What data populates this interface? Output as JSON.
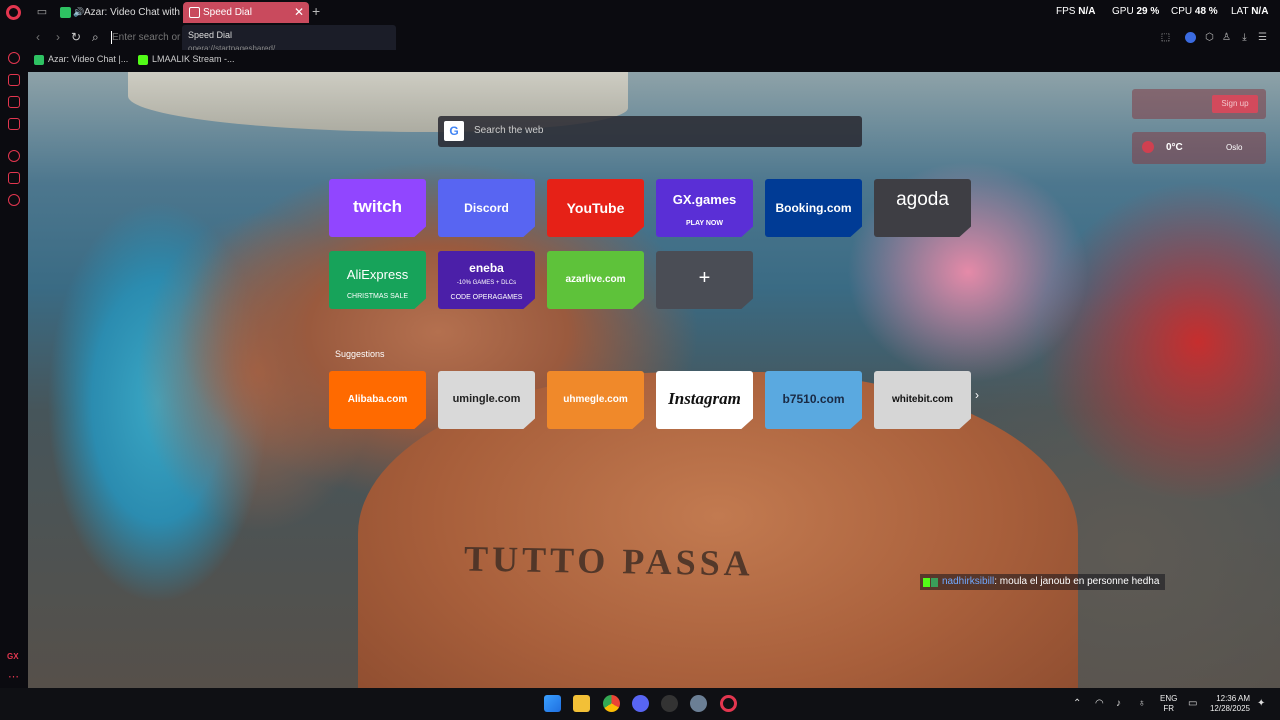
{
  "tabs": {
    "azar_title": "Azar: Video Chat with f",
    "speed_dial_title": "Speed Dial",
    "tooltip_title": "Speed Dial",
    "tooltip_url": "opera://startpageshared/"
  },
  "stats": {
    "fps_label": "FPS",
    "fps_value": "N/A",
    "gpu_label": "GPU",
    "gpu_value": "29 %",
    "cpu_label": "CPU",
    "cpu_value": "48 %",
    "lat_label": "LAT",
    "lat_value": "N/A"
  },
  "address": {
    "placeholder": "Enter search or w"
  },
  "bookmarks": [
    {
      "label": "Azar: Video Chat |...",
      "color": "#2ec262"
    },
    {
      "label": "LMAALIK Stream -...",
      "color": "#53fc18"
    }
  ],
  "search": {
    "placeholder": "Search the web",
    "engine_letter": "G"
  },
  "widgets": {
    "signup_label": "Sign up",
    "temperature": "0°C",
    "city": "Oslo"
  },
  "speed_dial": [
    {
      "label": "twitch",
      "bg": "#9146ff",
      "color": "#ffffff"
    },
    {
      "label": "Discord",
      "bg": "#5865f2",
      "color": "#ffffff"
    },
    {
      "label": "YouTube",
      "bg": "#e62117",
      "color": "#ffffff"
    },
    {
      "label": "GX.games",
      "sub": "PLAY NOW",
      "bg": "#5a2fd6",
      "color": "#ffffff"
    },
    {
      "label": "Booking.com",
      "bg": "#003b95",
      "color": "#ffffff"
    },
    {
      "label": "agoda",
      "bg": "#3e3e44",
      "color": "#ffffff"
    },
    {
      "label": "AliExpress",
      "sub": "CHRISTMAS SALE",
      "bg": "#17a35a",
      "color": "#ffffff"
    },
    {
      "label": "eneba",
      "sub": "CODE OPERAGAMES",
      "bg": "#4b1fa8",
      "color": "#ffffff"
    },
    {
      "label": "azarlive.com",
      "bg": "#5ec23a",
      "color": "#ffffff"
    },
    {
      "label": "+",
      "bg": "#4a4d55",
      "color": "#ffffff"
    }
  ],
  "eneba_note": "-10% GAMES + DLCs",
  "suggestions_title": "Suggestions",
  "suggestions": [
    {
      "label": "Alibaba.com",
      "bg": "#ff6a00",
      "color": "#ffffff"
    },
    {
      "label": "umingle.com",
      "bg": "#d9d9d9",
      "color": "#222222"
    },
    {
      "label": "uhmegle.com",
      "bg": "#f0892a",
      "color": "#ffffff"
    },
    {
      "label": "Instagram",
      "bg": "#ffffff",
      "color": "#111111"
    },
    {
      "label": "b7510.com",
      "bg": "#5aa9e0",
      "color": "#1a2a44"
    },
    {
      "label": "whitebit.com",
      "bg": "#d6d6d6",
      "color": "#111111"
    }
  ],
  "wallpaper_text": "TUTTO PASSA",
  "chat": {
    "user": "nadhirksibill",
    "message": ": moula el janoub en personne hedha"
  },
  "taskbar": {
    "lang_top": "ENG",
    "lang_bottom": "FR",
    "time": "12:36 AM",
    "date": "12/28/2025"
  },
  "sidebar": {
    "gx_label": "GX"
  },
  "colors": {
    "accent": "#e3364f",
    "active_tab": "#c94a5d"
  }
}
